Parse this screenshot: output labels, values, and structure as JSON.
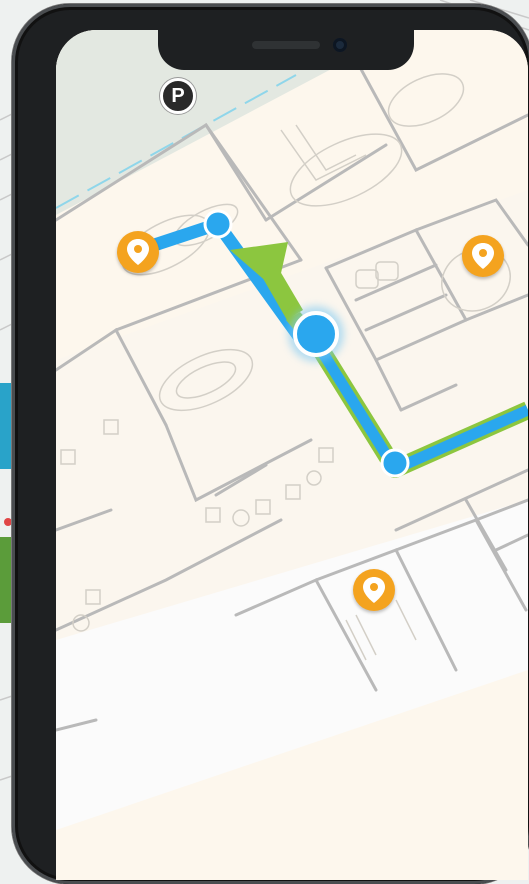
{
  "map": {
    "parking_marker": {
      "label": "P",
      "icon": "parking-icon"
    },
    "poi_markers": [
      {
        "icon": "location-pin-icon",
        "color": "#f4a31f"
      },
      {
        "icon": "location-pin-icon",
        "color": "#f4a31f"
      },
      {
        "icon": "location-pin-icon",
        "color": "#f4a31f"
      }
    ],
    "colors": {
      "route": "#2aa7ee",
      "direction_arrow": "#8cc63f",
      "floor": "#fdf7ed",
      "walls": "#bdbdbd",
      "outside_area": "#e6e9e3"
    }
  }
}
